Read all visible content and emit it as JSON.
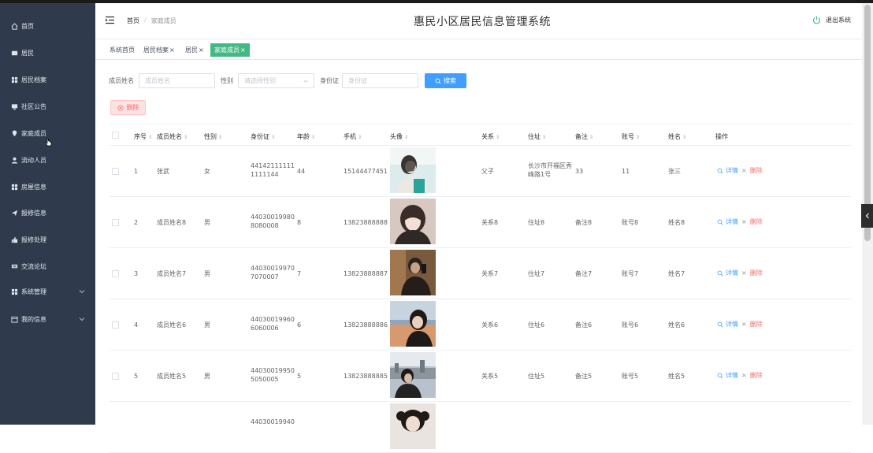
{
  "app": {
    "title": "惠民小区居民信息管理系统",
    "logout_label": "退出系统"
  },
  "breadcrumb": {
    "home": "首页",
    "sep": "/",
    "current": "家庭成员"
  },
  "sidebar": {
    "items": [
      {
        "label": "首页",
        "icon": "home-icon"
      },
      {
        "label": "居民",
        "icon": "list-icon"
      },
      {
        "label": "居民档案",
        "icon": "grid-icon"
      },
      {
        "label": "社区公告",
        "icon": "monitor-icon"
      },
      {
        "label": "家庭成员",
        "icon": "pin-icon"
      },
      {
        "label": "流动人员",
        "icon": "user-icon"
      },
      {
        "label": "房屋信息",
        "icon": "grid-icon"
      },
      {
        "label": "报修信息",
        "icon": "send-icon"
      },
      {
        "label": "报修处理",
        "icon": "thumb-icon"
      },
      {
        "label": "交流论坛",
        "icon": "chat-icon"
      },
      {
        "label": "系统管理",
        "icon": "grid-icon",
        "expandable": true
      },
      {
        "label": "我的信息",
        "icon": "calendar-icon",
        "expandable": true
      }
    ]
  },
  "tabs": [
    {
      "label": "系统首页",
      "closable": false,
      "active": false
    },
    {
      "label": "居民档案",
      "closable": true,
      "active": false
    },
    {
      "label": "居民",
      "closable": true,
      "active": false
    },
    {
      "label": "家庭成员",
      "closable": true,
      "active": true
    }
  ],
  "tab_close": "×",
  "search": {
    "name_label": "成员姓名",
    "name_placeholder": "成员姓名",
    "gender_label": "性别",
    "gender_placeholder": "请选择性别",
    "id_label": "身份证",
    "id_placeholder": "身份证",
    "button_label": "搜索"
  },
  "delete_button_label": "删除",
  "table": {
    "columns": [
      "序号",
      "成员姓名",
      "性别",
      "身份证",
      "年龄",
      "手机",
      "头像",
      "关系",
      "住址",
      "备注",
      "账号",
      "姓名",
      "操作"
    ],
    "action_detail": "详情",
    "action_delete": "删除",
    "action_sep": "×",
    "rows": [
      {
        "no": "1",
        "name": "张武",
        "gender": "女",
        "id_line1": "44142111111",
        "id_line2": "1111144",
        "age": "44",
        "phone": "15144477451",
        "relation": "父子",
        "addr_line1": "长沙市开福区秀",
        "addr_line2": "峰路1号",
        "note": "33",
        "account": "11",
        "realname": "张三"
      },
      {
        "no": "2",
        "name": "成员姓名8",
        "gender": "男",
        "id_line1": "44030019980",
        "id_line2": "8080008",
        "age": "8",
        "phone": "13823888888",
        "relation": "关系8",
        "addr_line1": "住址8",
        "addr_line2": "",
        "note": "备注8",
        "account": "账号8",
        "realname": "姓名8"
      },
      {
        "no": "3",
        "name": "成员姓名7",
        "gender": "男",
        "id_line1": "44030019970",
        "id_line2": "7070007",
        "age": "7",
        "phone": "13823888887",
        "relation": "关系7",
        "addr_line1": "住址7",
        "addr_line2": "",
        "note": "备注7",
        "account": "账号7",
        "realname": "姓名7"
      },
      {
        "no": "4",
        "name": "成员姓名6",
        "gender": "男",
        "id_line1": "44030019960",
        "id_line2": "6060006",
        "age": "6",
        "phone": "13823888886",
        "relation": "关系6",
        "addr_line1": "住址6",
        "addr_line2": "",
        "note": "备注6",
        "account": "账号6",
        "realname": "姓名6"
      },
      {
        "no": "5",
        "name": "成员姓名5",
        "gender": "男",
        "id_line1": "44030019950",
        "id_line2": "5050005",
        "age": "5",
        "phone": "13823888885",
        "relation": "关系5",
        "addr_line1": "住址5",
        "addr_line2": "",
        "note": "备注5",
        "account": "账号5",
        "realname": "姓名5"
      },
      {
        "no": "",
        "name": "",
        "gender": "",
        "id_line1": "44030019940",
        "id_line2": "",
        "age": "",
        "phone": "",
        "relation": "",
        "addr_line1": "",
        "addr_line2": "",
        "note": "",
        "account": "",
        "realname": ""
      }
    ]
  },
  "colors": {
    "sidebar_bg": "#2f3b4d",
    "active_tab": "#42b983",
    "primary": "#409eff",
    "danger": "#f56c6c"
  }
}
